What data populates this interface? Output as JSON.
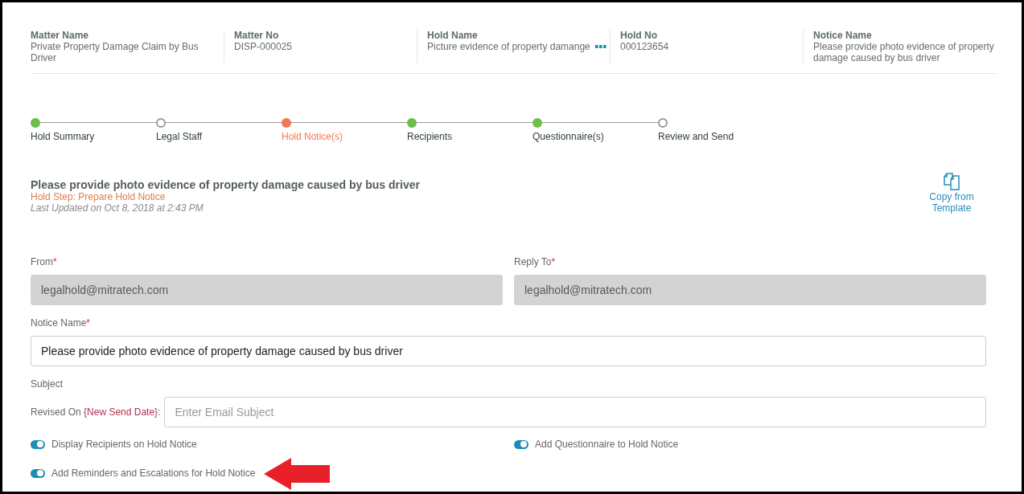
{
  "summary": [
    {
      "label": "Matter Name",
      "value": "Private Property Damage Claim by Bus Driver"
    },
    {
      "label": "Matter No",
      "value": "DISP-000025"
    },
    {
      "label": "Hold Name",
      "value": "Picture evidence of property damange",
      "more": true
    },
    {
      "label": "Hold No",
      "value": "000123654"
    },
    {
      "label": "Notice Name",
      "value": "Please provide photo evidence of property damage caused by bus driver"
    }
  ],
  "steps": [
    {
      "label": "Hold Summary",
      "done": true,
      "selected": false
    },
    {
      "label": "Legal Staff",
      "done": false,
      "selected": false
    },
    {
      "label": "Hold Notice(s)",
      "done": false,
      "selected": true
    },
    {
      "label": "Recipients",
      "done": true,
      "selected": false
    },
    {
      "label": "Questionnaire(s)",
      "done": true,
      "selected": false
    },
    {
      "label": "Review and Send",
      "done": false,
      "selected": false
    }
  ],
  "notice": {
    "title": "Please provide photo evidence of property damage caused by bus driver",
    "step": "Hold Step: Prepare Hold Notice",
    "updated": "Last Updated on Oct 8, 2018 at 2:43 PM"
  },
  "copy_button": {
    "label": "Copy from Template"
  },
  "fields": [
    {
      "label": "From",
      "required": "*",
      "value": "legalhold@mitratech.com",
      "disabled": true
    },
    {
      "label": "Reply To",
      "required": "*",
      "value": "legalhold@mitratech.com",
      "disabled": true
    }
  ],
  "notice_name": {
    "label": "Notice Name",
    "required": "*",
    "value": "Please provide photo evidence of property damage caused by bus driver"
  },
  "subject": {
    "label": "Subject",
    "prefix": "Revised On",
    "token": "{New Send Date}",
    "suffix": ":",
    "placeholder": "Enter Email Subject"
  },
  "toggles": [
    {
      "label": "Display Recipients on Hold Notice",
      "on": true
    },
    {
      "label": "Add Questionnaire to Hold Notice",
      "on": true
    },
    {
      "label": "Add Reminders and Escalations for Hold Notice",
      "on": true
    }
  ]
}
